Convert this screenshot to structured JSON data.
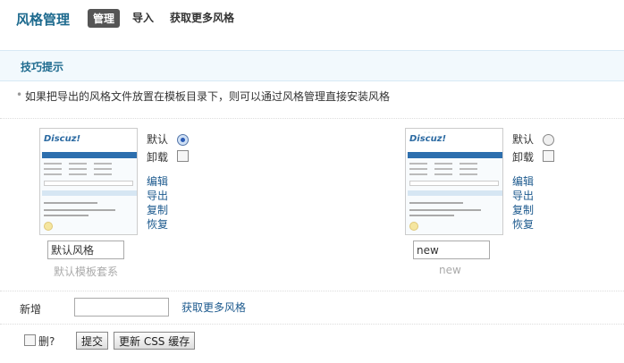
{
  "header": {
    "title": "风格管理",
    "tabs": [
      {
        "label": "管理",
        "active": true
      },
      {
        "label": "导入",
        "active": false
      },
      {
        "label": "获取更多风格",
        "active": false
      }
    ]
  },
  "tips": {
    "title": "技巧提示",
    "text": "如果把导出的风格文件放置在模板目录下，则可以通过风格管理直接安装风格"
  },
  "styles": [
    {
      "thumb_logo": "Discuz!",
      "default_label": "默认",
      "default_selected": true,
      "uninstall_label": "卸载",
      "uninstall_checked": false,
      "actions": [
        "编辑",
        "导出",
        "复制",
        "恢复"
      ],
      "name_value": "默认风格",
      "template_caption": "默认模板套系"
    },
    {
      "thumb_logo": "Discuz!",
      "default_label": "默认",
      "default_selected": false,
      "uninstall_label": "卸载",
      "uninstall_checked": false,
      "actions": [
        "编辑",
        "导出",
        "复制",
        "恢复"
      ],
      "name_value": "new",
      "template_caption": "new"
    }
  ],
  "add": {
    "label": "新增",
    "input_value": "",
    "more_link": "获取更多风格"
  },
  "footer": {
    "delete_label": "删?",
    "delete_checked": false,
    "submit_label": "提交",
    "update_css_label": "更新 CSS 缓存"
  },
  "colors": {
    "accent": "#1d6a8e",
    "tips_background": "#f2f9fd",
    "link": "#1d5a8e"
  }
}
